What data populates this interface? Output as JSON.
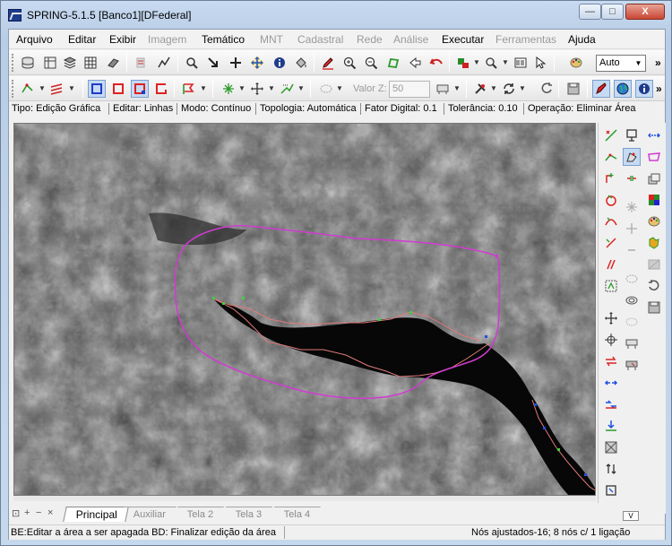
{
  "window": {
    "title": "SPRING-5.1.5 [Banco1][DFederal]",
    "minimize": "—",
    "maximize": "□",
    "close": "X"
  },
  "menu": [
    {
      "label": "Arquivo",
      "enabled": true
    },
    {
      "label": "Editar",
      "enabled": true
    },
    {
      "label": "Exibir",
      "enabled": true
    },
    {
      "label": "Imagem",
      "enabled": false
    },
    {
      "label": "Temático",
      "enabled": true
    },
    {
      "label": "MNT",
      "enabled": false
    },
    {
      "label": "Cadastral",
      "enabled": false
    },
    {
      "label": "Rede",
      "enabled": false
    },
    {
      "label": "Análise",
      "enabled": false
    },
    {
      "label": "Executar",
      "enabled": true
    },
    {
      "label": "Ferramentas",
      "enabled": false
    },
    {
      "label": "Ajuda",
      "enabled": true
    }
  ],
  "toolbar1": {
    "zoom_select": "Auto",
    "more": "»"
  },
  "toolbar2": {
    "valor_z_label": "Valor Z:",
    "valor_z_value": "50",
    "more": "»"
  },
  "edit_status": {
    "tipo": "Tipo: Edição Gráfica",
    "editar": "Editar: Linhas",
    "modo": "Modo: Contínuo",
    "topologia": "Topologia: Automática",
    "fator": "Fator Digital: 0.1",
    "tolerancia": "Tolerância: 0.10",
    "operacao": "Operação: Eliminar Área"
  },
  "tabs": [
    {
      "label": "Principal",
      "active": true
    },
    {
      "label": "Auxiliar",
      "active": false
    },
    {
      "label": "Tela 2",
      "active": false
    },
    {
      "label": "Tela 3",
      "active": false
    },
    {
      "label": "Tela 4",
      "active": false
    }
  ],
  "tab_controls": [
    "⊡",
    "+",
    "−",
    "×"
  ],
  "panel_toggle": "V",
  "statusbar": {
    "left": "BE:Editar a área a ser apagada BD: Finalizar edição da área",
    "right": "Nós ajustados-16; 8 nós c/ 1 ligação"
  },
  "colors": {
    "polygon": "#d23ad2",
    "edited_line": "#e08a8a",
    "node_green": "#3fcf3f",
    "node_blue": "#2050e0",
    "accent": "#1e3c8c"
  }
}
